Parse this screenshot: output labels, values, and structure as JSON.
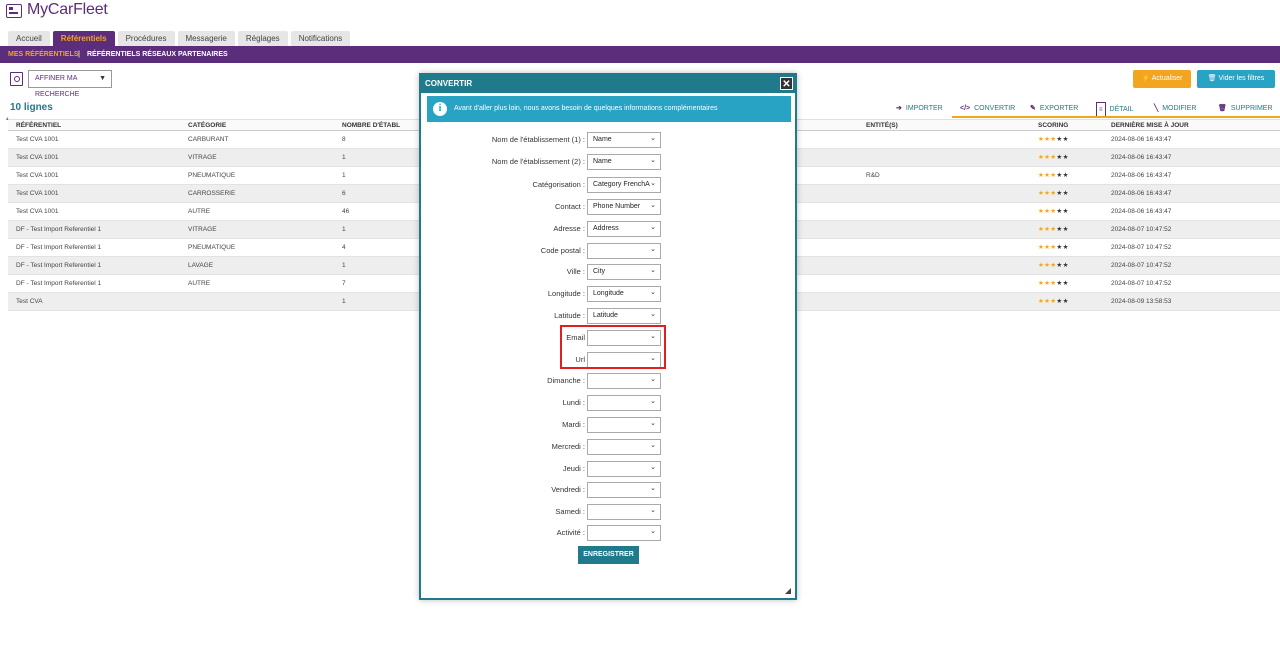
{
  "app": {
    "title": "MyCarFleet"
  },
  "tabs": [
    {
      "label": "Accueil",
      "active": false
    },
    {
      "label": "Référentiels",
      "active": true
    },
    {
      "label": "Procédures",
      "active": false
    },
    {
      "label": "Messagerie",
      "active": false
    },
    {
      "label": "Réglages",
      "active": false
    },
    {
      "label": "Notifications",
      "active": false
    }
  ],
  "subnav": {
    "mine": "MES RÉFÉRENTIELS",
    "separator": "|",
    "partners": "RÉFÉRENTIELS RÉSEAUX PARTENAIRES"
  },
  "toolbar": {
    "refine_label": "AFFINER MA RECHERCHE",
    "refresh_label": "Actualiser",
    "clear_filters_label": "Vider les filtres",
    "row_count": "10 lignes"
  },
  "actions": {
    "importer": "IMPORTER",
    "convertir": "CONVERTIR",
    "exporter": "EXPORTER",
    "detail": "DÉTAIL",
    "modifier": "MODIFIER",
    "supprimer": "SUPPRIMER"
  },
  "table": {
    "headers": {
      "referentiel": "RÉFÉRENTIEL",
      "categorie": "CATÉGORIE",
      "nombre": "NOMBRE D'ÉTABL",
      "entites": "ENTITÉ(S)",
      "scoring": "SCORING",
      "date": "DERNIÈRE MISE À JOUR"
    },
    "rows": [
      {
        "referentiel": "Test CVA 1001",
        "categorie": "CARBURANT",
        "nombre": "8",
        "entites": "",
        "date": "2024-08-06 16:43:47"
      },
      {
        "referentiel": "Test CVA 1001",
        "categorie": "VITRAGE",
        "nombre": "1",
        "entites": "",
        "date": "2024-08-06 16:43:47"
      },
      {
        "referentiel": "Test CVA 1001",
        "categorie": "PNEUMATIQUE",
        "nombre": "1",
        "entites": "R&D",
        "date": "2024-08-06 16:43:47"
      },
      {
        "referentiel": "Test CVA 1001",
        "categorie": "CARROSSERIE",
        "nombre": "6",
        "entites": "",
        "date": "2024-08-06 16:43:47"
      },
      {
        "referentiel": "Test CVA 1001",
        "categorie": "AUTRE",
        "nombre": "46",
        "entites": "",
        "date": "2024-08-06 16:43:47"
      },
      {
        "referentiel": "DF - Test Import Referentiel 1",
        "categorie": "VITRAGE",
        "nombre": "1",
        "entites": "",
        "date": "2024-08-07 10:47:52"
      },
      {
        "referentiel": "DF - Test Import Referentiel 1",
        "categorie": "PNEUMATIQUE",
        "nombre": "4",
        "entites": "",
        "date": "2024-08-07 10:47:52"
      },
      {
        "referentiel": "DF - Test Import Referentiel 1",
        "categorie": "LAVAGE",
        "nombre": "1",
        "entites": "",
        "date": "2024-08-07 10:47:52"
      },
      {
        "referentiel": "DF - Test Import Referentiel 1",
        "categorie": "AUTRE",
        "nombre": "7",
        "entites": "",
        "date": "2024-08-07 10:47:52"
      },
      {
        "referentiel": "Test CVA",
        "categorie": "",
        "nombre": "1",
        "entites": "",
        "date": "2024-08-09 13:58:53"
      }
    ],
    "scoring": {
      "filled": 3,
      "total": 5
    }
  },
  "modal": {
    "title": "CONVERTIR",
    "close": "✕",
    "info": "Avant d'aller plus loin, nous avons besoin de quelques informations complémentaires",
    "fields": [
      {
        "label": "Nom de l'établissement (1) :",
        "value": "Name"
      },
      {
        "label": "Nom de l'établissement (2) :",
        "value": "Name"
      },
      {
        "label": "Catégorisation :",
        "value": "Category FrenchA"
      },
      {
        "label": "Contact :",
        "value": "Phone Number"
      },
      {
        "label": "Adresse :",
        "value": "Address"
      },
      {
        "label": "Code postal :",
        "value": ""
      },
      {
        "label": "Ville :",
        "value": "City"
      },
      {
        "label": "Longitude :",
        "value": "Longitude"
      },
      {
        "label": "Latitude :",
        "value": "Latitude"
      },
      {
        "label": "Email",
        "value": ""
      },
      {
        "label": "Url",
        "value": ""
      },
      {
        "label": "Dimanche :",
        "value": ""
      },
      {
        "label": "Lundi :",
        "value": ""
      },
      {
        "label": "Mardi :",
        "value": ""
      },
      {
        "label": "Mercredi :",
        "value": ""
      },
      {
        "label": "Jeudi :",
        "value": ""
      },
      {
        "label": "Vendredi :",
        "value": ""
      },
      {
        "label": "Samedi :",
        "value": ""
      },
      {
        "label": "Activité :",
        "value": ""
      }
    ],
    "save_label": "ENREGISTRER"
  },
  "colors": {
    "brand_purple": "#5c2d7a",
    "accent_orange": "#f3a521",
    "teal": "#1f7a8c",
    "info_blue": "#29a3c4",
    "highlight_red": "#e02020"
  }
}
